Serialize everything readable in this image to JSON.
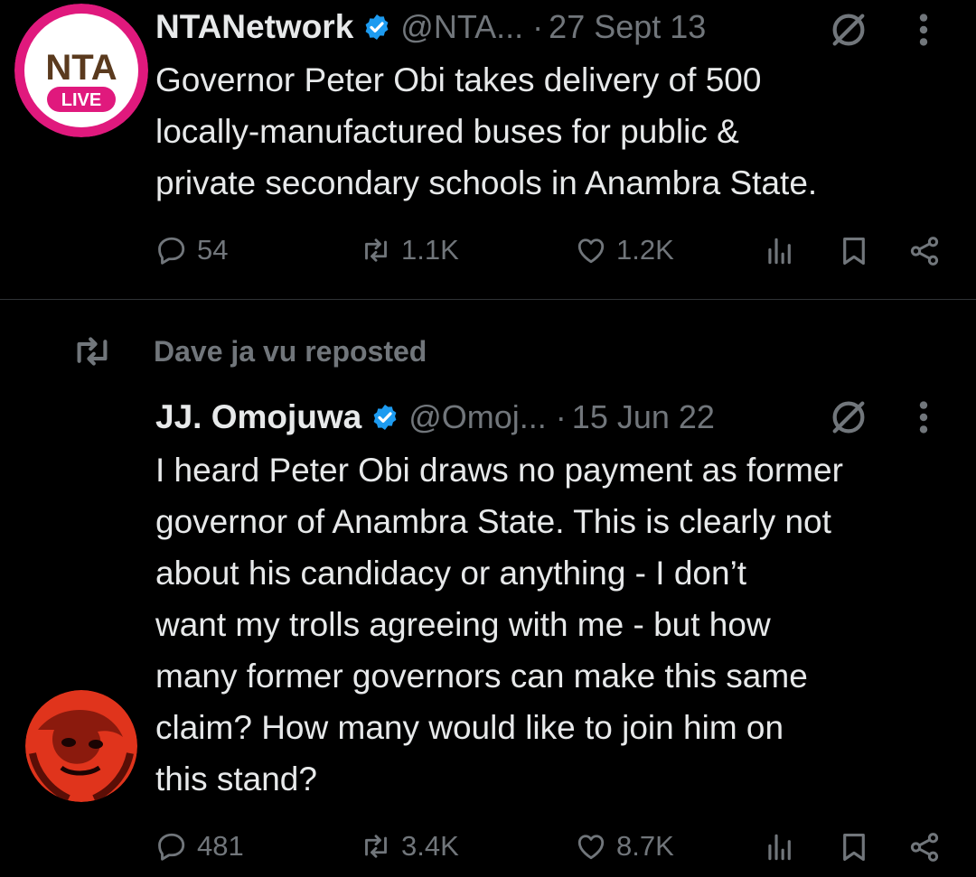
{
  "tweets": [
    {
      "display_name": "NTANetwork",
      "handle": "@NTA...",
      "dot": "·",
      "time": "27 Sept 13",
      "avatar_logo_text": "NTA",
      "avatar_badge": "LIVE",
      "text": "Governor Peter Obi takes delivery of 500\nlocally-manufactured buses for public &\nprivate secondary schools in Anambra State.",
      "stats": {
        "replies": "54",
        "reposts": "1.1K",
        "likes": "1.2K"
      }
    },
    {
      "display_name": "JJ. Omojuwa",
      "handle": "@Omoj...",
      "dot": "·",
      "time": "15 Jun 22",
      "text": "I heard Peter Obi draws no payment as former\ngovernor of Anambra State. This is clearly not\nabout his candidacy or anything - I don’t\nwant my trolls agreeing with me - but how\nmany former governors can make this same\nclaim? How many would like to join him on\nthis stand?",
      "stats": {
        "replies": "481",
        "reposts": "3.4K",
        "likes": "8.7K"
      }
    }
  ],
  "repost_context": "Dave ja vu reposted",
  "colors": {
    "background": "#000000",
    "text_primary": "#e7e9ea",
    "text_secondary": "#71767b",
    "verified": "#1d9bf0",
    "divider": "#2f3336",
    "nta_ring": "#e0197d"
  },
  "icons": [
    "verified-badge-icon",
    "grok-icon",
    "more-icon",
    "reply-icon",
    "repost-icon",
    "like-icon",
    "views-icon",
    "bookmark-icon",
    "share-icon"
  ]
}
